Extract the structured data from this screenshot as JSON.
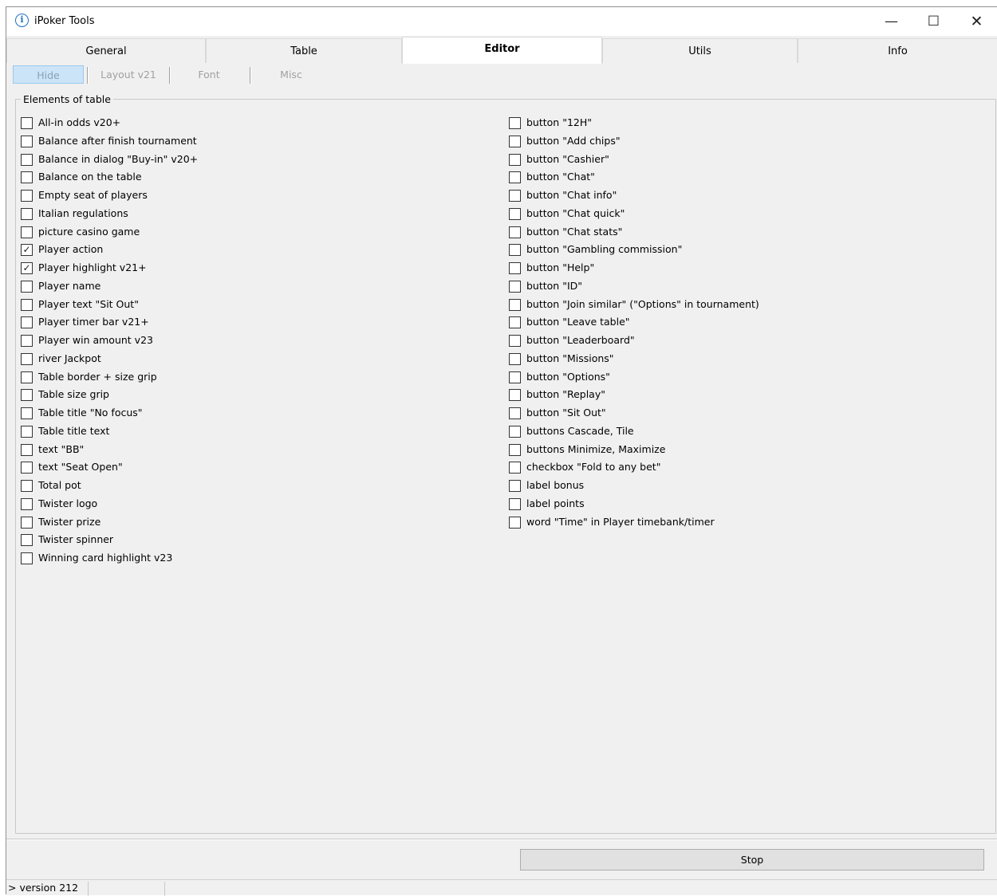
{
  "window": {
    "title": "iPoker Tools",
    "app_icon": "info-icon"
  },
  "tabs": [
    "General",
    "Table",
    "Editor",
    "Utils",
    "Info"
  ],
  "active_tab": "Editor",
  "subtabs": [
    "Hide",
    "Layout v21",
    "Font",
    "Misc"
  ],
  "group_title": "Elements of table",
  "left_items": [
    {
      "label": "All-in odds v20+",
      "checked": false
    },
    {
      "label": "Balance after finish tournament",
      "checked": false
    },
    {
      "label": "Balance in dialog \"Buy-in\" v20+",
      "checked": false
    },
    {
      "label": "Balance on the table",
      "checked": false
    },
    {
      "label": "Empty seat of players",
      "checked": false
    },
    {
      "label": "Italian regulations",
      "checked": false
    },
    {
      "label": "picture casino game",
      "checked": false
    },
    {
      "label": "Player action",
      "checked": true
    },
    {
      "label": "Player highlight v21+",
      "checked": true
    },
    {
      "label": "Player name",
      "checked": false
    },
    {
      "label": "Player text \"Sit Out\"",
      "checked": false
    },
    {
      "label": "Player timer bar v21+",
      "checked": false
    },
    {
      "label": "Player win amount v23",
      "checked": false
    },
    {
      "label": "river Jackpot",
      "checked": false
    },
    {
      "label": "Table border + size grip",
      "checked": false
    },
    {
      "label": "Table size grip",
      "checked": false
    },
    {
      "label": "Table title \"No focus\"",
      "checked": false
    },
    {
      "label": "Table title text",
      "checked": false
    },
    {
      "label": "text \"BB\"",
      "checked": false
    },
    {
      "label": "text \"Seat Open\"",
      "checked": false
    },
    {
      "label": "Total pot",
      "checked": false
    },
    {
      "label": "Twister logo",
      "checked": false
    },
    {
      "label": "Twister prize",
      "checked": false
    },
    {
      "label": "Twister spinner",
      "checked": false
    },
    {
      "label": "Winning card highlight v23",
      "checked": false
    }
  ],
  "right_items": [
    {
      "label": "button \"12H\"",
      "checked": false
    },
    {
      "label": "button \"Add chips\"",
      "checked": false
    },
    {
      "label": "button \"Cashier\"",
      "checked": false
    },
    {
      "label": "button \"Chat\"",
      "checked": false
    },
    {
      "label": "button \"Chat info\"",
      "checked": false
    },
    {
      "label": "button \"Chat quick\"",
      "checked": false
    },
    {
      "label": "button \"Chat stats\"",
      "checked": false
    },
    {
      "label": "button \"Gambling commission\"",
      "checked": false
    },
    {
      "label": "button \"Help\"",
      "checked": false
    },
    {
      "label": "button \"ID\"",
      "checked": false
    },
    {
      "label": "button \"Join similar\" (\"Options\" in tournament)",
      "checked": false
    },
    {
      "label": "button \"Leave table\"",
      "checked": false
    },
    {
      "label": "button \"Leaderboard\"",
      "checked": false
    },
    {
      "label": "button \"Missions\"",
      "checked": false
    },
    {
      "label": "button \"Options\"",
      "checked": false
    },
    {
      "label": "button \"Replay\"",
      "checked": false
    },
    {
      "label": "button \"Sit Out\"",
      "checked": false
    },
    {
      "label": "buttons Cascade, Tile",
      "checked": false
    },
    {
      "label": "buttons Minimize, Maximize",
      "checked": false
    },
    {
      "label": "checkbox \"Fold to any bet\"",
      "checked": false
    },
    {
      "label": "label bonus",
      "checked": false
    },
    {
      "label": "label points",
      "checked": false
    },
    {
      "label": "word \"Time\" in Player timebank/timer",
      "checked": false
    }
  ],
  "stop_label": "Stop",
  "status_text": "> version 212"
}
